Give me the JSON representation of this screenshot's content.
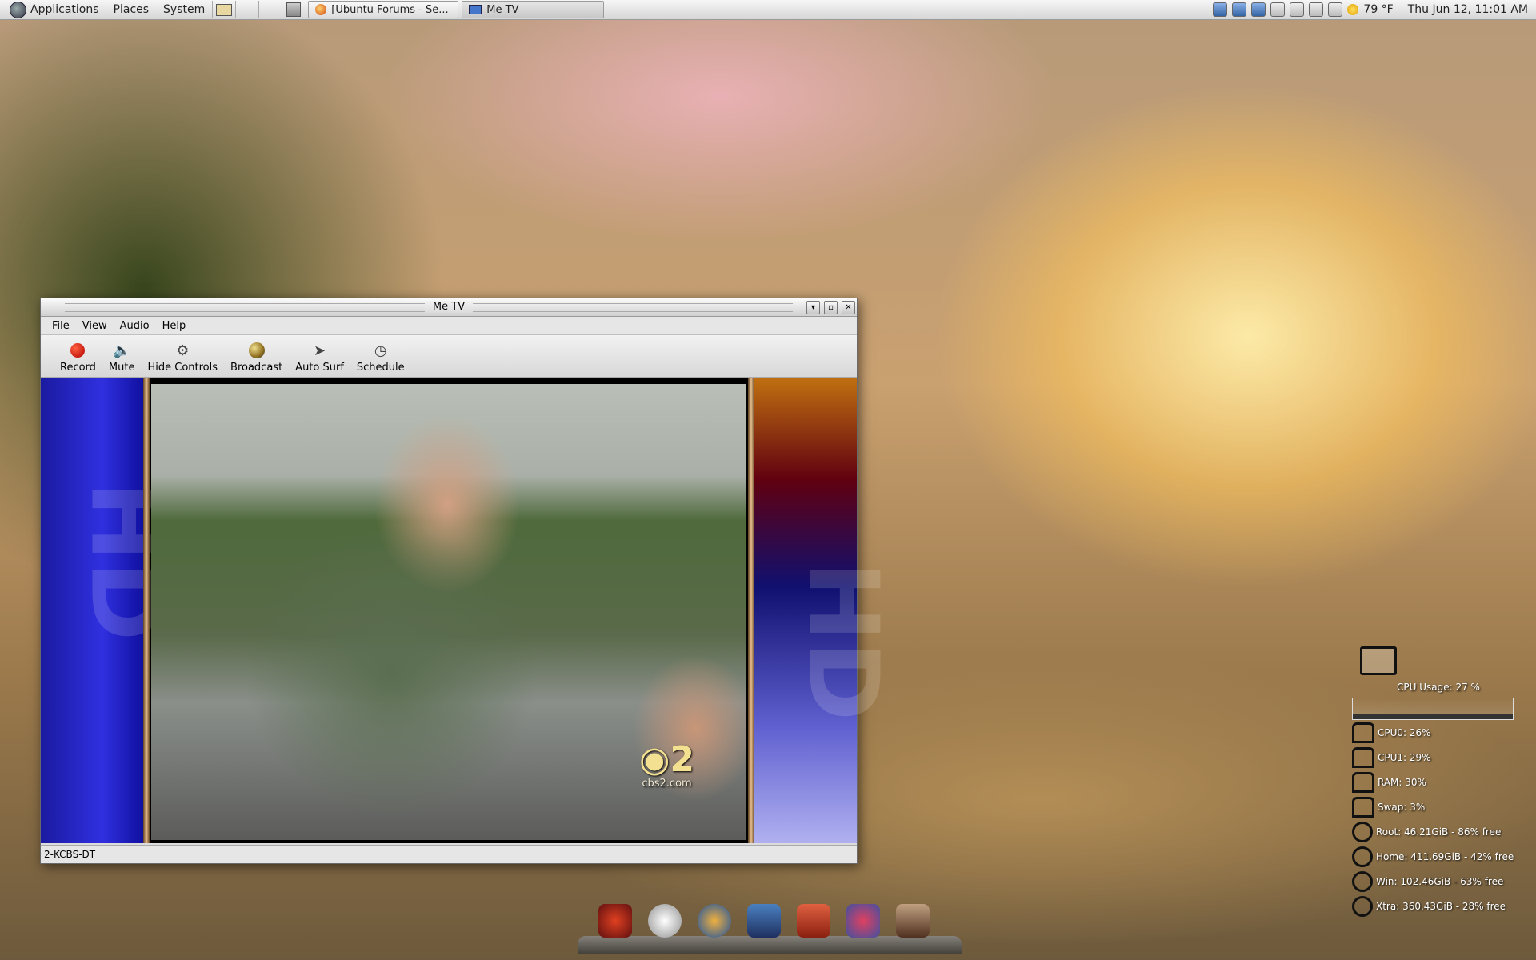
{
  "top_panel": {
    "menus": [
      "Applications",
      "Places",
      "System"
    ],
    "tasks": [
      {
        "label": "[Ubuntu Forums - Se...",
        "icon": "firefox-icon"
      },
      {
        "label": "Me TV",
        "icon": "tv-icon"
      }
    ],
    "weather": "79 °F",
    "clock": "Thu Jun 12, 11:01 AM"
  },
  "window": {
    "title": "Me TV",
    "menu": [
      "File",
      "View",
      "Audio",
      "Help"
    ],
    "toolbar": [
      {
        "label": "Record",
        "icon": "record-icon"
      },
      {
        "label": "Mute",
        "icon": "speaker-icon"
      },
      {
        "label": "Hide Controls",
        "icon": "hide-controls-icon"
      },
      {
        "label": "Broadcast",
        "icon": "broadcast-icon"
      },
      {
        "label": "Auto Surf",
        "icon": "auto-surf-icon"
      },
      {
        "label": "Schedule",
        "icon": "clock-icon"
      }
    ],
    "video_overlay": {
      "logo_text": "2",
      "logo_url": "cbs2.com",
      "side_left": "HD",
      "side_right": "HD"
    },
    "status": "2-KCBS-DT"
  },
  "system_monitor": {
    "cpu_usage": "CPU Usage: 27 %",
    "rows": [
      "CPU0: 26%",
      "CPU1: 29%",
      "RAM: 30%",
      "Swap: 3%",
      "Root: 46.21GiB - 86% free",
      "Home: 411.69GiB - 42% free",
      "Win: 102.46GiB - 63% free",
      "Xtra: 360.43GiB - 28% free"
    ]
  },
  "colors": {
    "accent_blue": "#3030e0",
    "record_red": "#c00000",
    "panel": "#e0e0e0"
  }
}
